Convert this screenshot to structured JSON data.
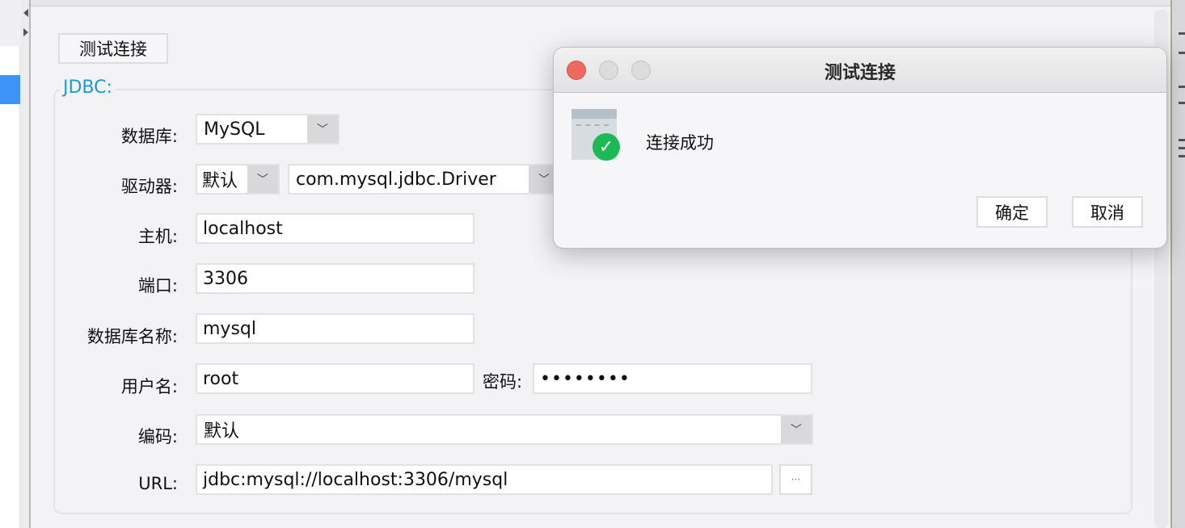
{
  "toolbar": {
    "test_connection_label": "测试连接"
  },
  "jdbc": {
    "legend": "JDBC:",
    "database": {
      "label": "数据库:",
      "value": "MySQL"
    },
    "driver": {
      "label": "驱动器:",
      "mode": "默认",
      "class": "com.mysql.jdbc.Driver"
    },
    "host": {
      "label": "主机:",
      "value": "localhost"
    },
    "port": {
      "label": "端口:",
      "value": "3306"
    },
    "db_name": {
      "label": "数据库名称:",
      "value": "mysql"
    },
    "username": {
      "label": "用户名:",
      "value": "root"
    },
    "password": {
      "label": "密码:",
      "value": "••••••••"
    },
    "encoding": {
      "label": "编码:",
      "value": "默认"
    },
    "url": {
      "label": "URL:",
      "value": "jdbc:mysql://localhost:3306/mysql",
      "browse_label": "···"
    }
  },
  "dialog": {
    "title": "测试连接",
    "message": "连接成功",
    "ok_label": "确定",
    "cancel_label": "取消",
    "icon": "connection-success-icon"
  },
  "colors": {
    "accent": "#1a9bd8",
    "selection": "#3d93f7",
    "success": "#1db954",
    "close": "#ee6a5f"
  }
}
